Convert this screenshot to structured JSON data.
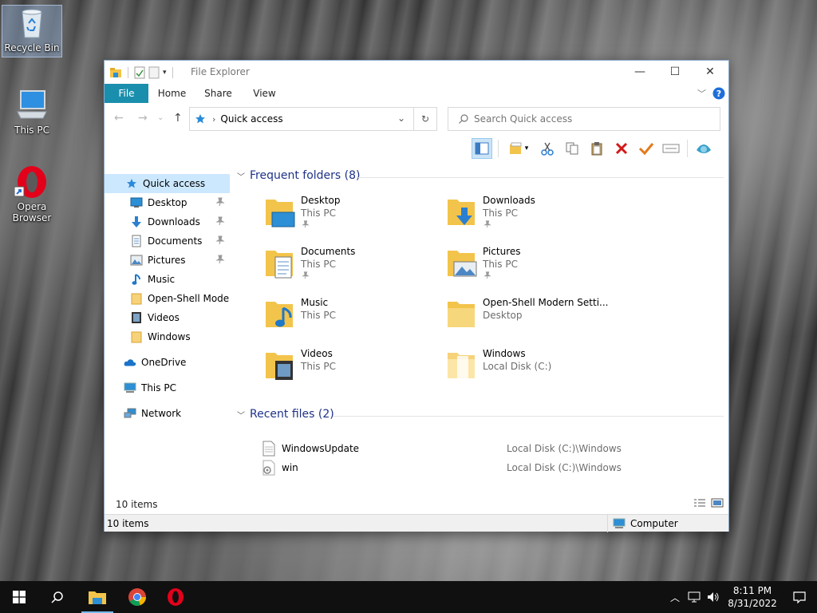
{
  "desktop": {
    "icons": [
      {
        "label": "Recycle Bin",
        "icon": "recycle-bin-icon"
      },
      {
        "label": "This PC",
        "icon": "computer-icon"
      },
      {
        "label": "Opera Browser",
        "icon": "opera-icon"
      }
    ]
  },
  "window": {
    "title": "File Explorer",
    "controls": {
      "minimize": "—",
      "maximize": "☐",
      "close": "✕"
    },
    "ribbon_tabs": [
      "File",
      "Home",
      "Share",
      "View"
    ],
    "address": {
      "current": "Quick access"
    },
    "search": {
      "placeholder": "Search Quick access"
    },
    "nav": {
      "items": [
        {
          "label": "Quick access",
          "icon": "quick-access-star-icon",
          "selected": true
        },
        {
          "label": "Desktop",
          "icon": "desktop-icon",
          "pinned": true
        },
        {
          "label": "Downloads",
          "icon": "downloads-icon",
          "pinned": true
        },
        {
          "label": "Documents",
          "icon": "documents-icon",
          "pinned": true
        },
        {
          "label": "Pictures",
          "icon": "pictures-icon",
          "pinned": true
        },
        {
          "label": "Music",
          "icon": "music-icon"
        },
        {
          "label": "Open-Shell Modern",
          "icon": "folder-icon"
        },
        {
          "label": "Videos",
          "icon": "videos-icon"
        },
        {
          "label": "Windows",
          "icon": "folder-icon"
        },
        {
          "label": "OneDrive",
          "icon": "onedrive-icon"
        },
        {
          "label": "This PC",
          "icon": "computer-icon"
        },
        {
          "label": "Network",
          "icon": "network-icon"
        }
      ]
    },
    "frequent": {
      "header": "Frequent folders (8)",
      "folders": [
        {
          "name": "Desktop",
          "location": "This PC",
          "pinned": true
        },
        {
          "name": "Downloads",
          "location": "This PC",
          "pinned": true
        },
        {
          "name": "Documents",
          "location": "This PC",
          "pinned": true
        },
        {
          "name": "Pictures",
          "location": "This PC",
          "pinned": true
        },
        {
          "name": "Music",
          "location": "This PC"
        },
        {
          "name": "Open-Shell Modern Setti...",
          "location": "Desktop"
        },
        {
          "name": "Videos",
          "location": "This PC"
        },
        {
          "name": "Windows",
          "location": "Local Disk (C:)"
        }
      ]
    },
    "recent": {
      "header": "Recent files (2)",
      "files": [
        {
          "name": "WindowsUpdate",
          "path": "Local Disk (C:)\\Windows"
        },
        {
          "name": "win",
          "path": "Local Disk (C:)\\Windows"
        }
      ]
    },
    "items_count": "10 items",
    "status": {
      "left": "10 items",
      "right": "Computer"
    }
  },
  "taskbar": {
    "time": "8:11 PM",
    "date": "8/31/2022"
  },
  "colors": {
    "file_tab": "#1a8fad",
    "selection": "#cce8ff",
    "group_header": "#1e3287"
  }
}
